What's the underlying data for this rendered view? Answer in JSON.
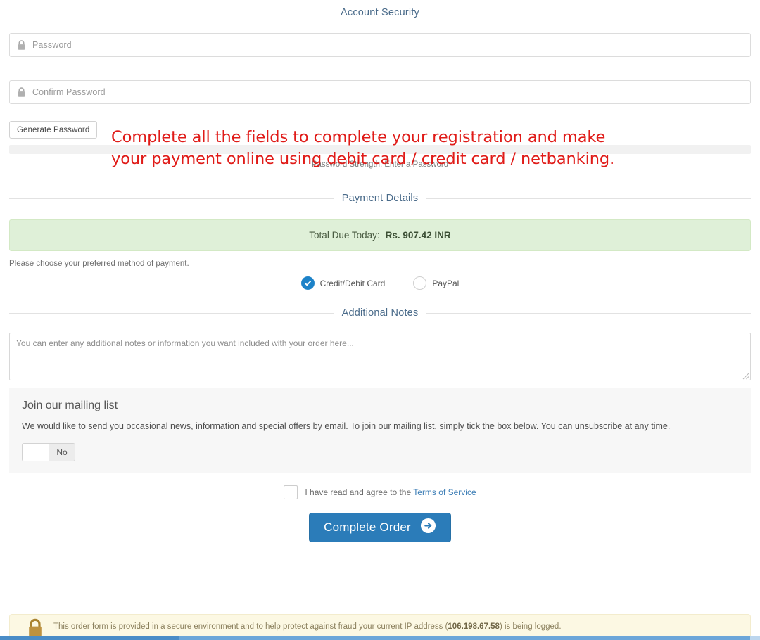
{
  "sections": {
    "account_security": "Account Security",
    "payment_details": "Payment Details",
    "additional_notes": "Additional Notes"
  },
  "account_security": {
    "password_placeholder": "Password",
    "confirm_password_placeholder": "Confirm Password",
    "generate_password_label": "Generate Password",
    "password_strength_label": "Password Strength: Enter a Password"
  },
  "annotation": {
    "line1": "Complete all the fields to complete your registration and make",
    "line2": "your payment online using debit card / credit card / netbanking.",
    "color": "#e01b18"
  },
  "payment": {
    "total_label": "Total Due Today:",
    "total_amount": "Rs. 907.42 INR",
    "choose_method_text": "Please choose your preferred method of payment.",
    "methods": [
      {
        "label": "Credit/Debit Card",
        "selected": true
      },
      {
        "label": "PayPal",
        "selected": false
      }
    ],
    "accent_color": "#1c82c8",
    "total_box_bg": "#dff0d8"
  },
  "notes": {
    "placeholder": "You can enter any additional notes or information you want included with your order here..."
  },
  "mailing_list": {
    "title": "Join our mailing list",
    "body": "We would like to send you occasional news, information and special offers by email. To join our mailing list, simply tick the box below. You can unsubscribe at any time.",
    "toggle_value": "No"
  },
  "terms": {
    "prefix": "I have read and agree to the ",
    "link": "Terms of Service",
    "checked": false
  },
  "submit": {
    "label": "Complete Order",
    "color": "#2b7cb9"
  },
  "security_notice": {
    "text_before_ip": "This order form is provided in a secure environment and to help protect against fraud your current IP address (",
    "ip": "106.198.67.58",
    "text_after_ip": ") is being logged.",
    "bg": "#fcf8e3"
  }
}
